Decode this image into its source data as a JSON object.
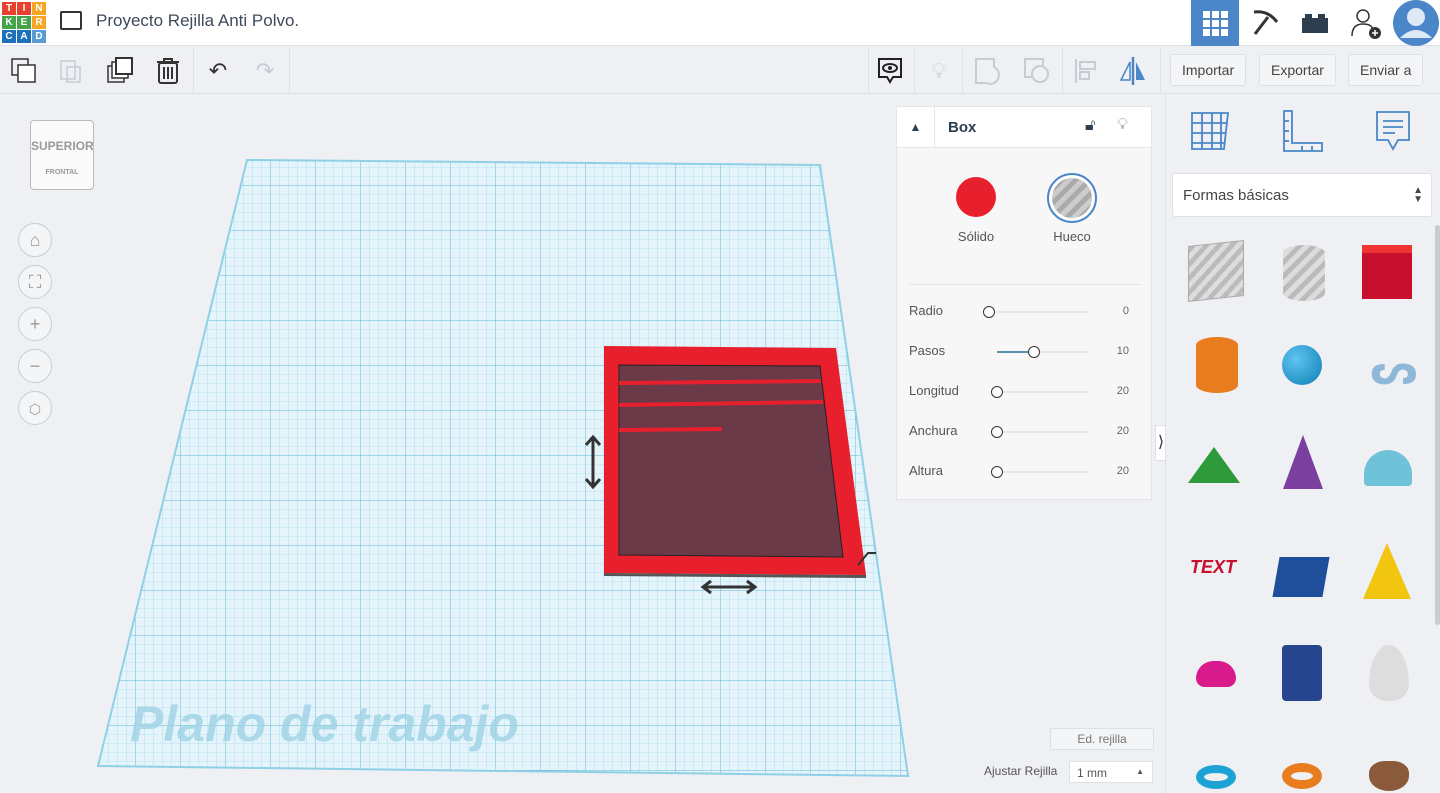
{
  "header": {
    "logo_letters": [
      "T",
      "I",
      "N",
      "K",
      "E",
      "R",
      "C",
      "A",
      "D"
    ],
    "logo_colors": [
      "#e8412c",
      "#e8412c",
      "#f6a623",
      "#45a34a",
      "#45a34a",
      "#f6a623",
      "#1d71b8",
      "#1d71b8",
      "#5a9bd4"
    ],
    "title": "Proyecto Rejilla Anti Polvo."
  },
  "toolbar": {
    "import": "Importar",
    "export": "Exportar",
    "send": "Enviar a"
  },
  "viewcube": {
    "top": "SUPERIOR",
    "front": "FRONTAL"
  },
  "workplane": {
    "label": "Plano de trabajo"
  },
  "inspector": {
    "title": "Box",
    "solid": "Sólido",
    "hole": "Hueco",
    "solid_color": "#e8202e",
    "params": [
      {
        "label": "Radio",
        "value": "0",
        "fraction": 0
      },
      {
        "label": "Pasos",
        "value": "10",
        "fraction": 0.4
      },
      {
        "label": "Longitud",
        "value": "20",
        "fraction": 0
      },
      {
        "label": "Anchura",
        "value": "20",
        "fraction": 0
      },
      {
        "label": "Altura",
        "value": "20",
        "fraction": 0
      }
    ]
  },
  "grid": {
    "edit": "Ed. rejilla",
    "snap_label": "Ajustar Rejilla",
    "snap_value": "1 mm"
  },
  "library": {
    "category": "Formas básicas"
  },
  "colors": {
    "accent": "#4a86c8"
  }
}
